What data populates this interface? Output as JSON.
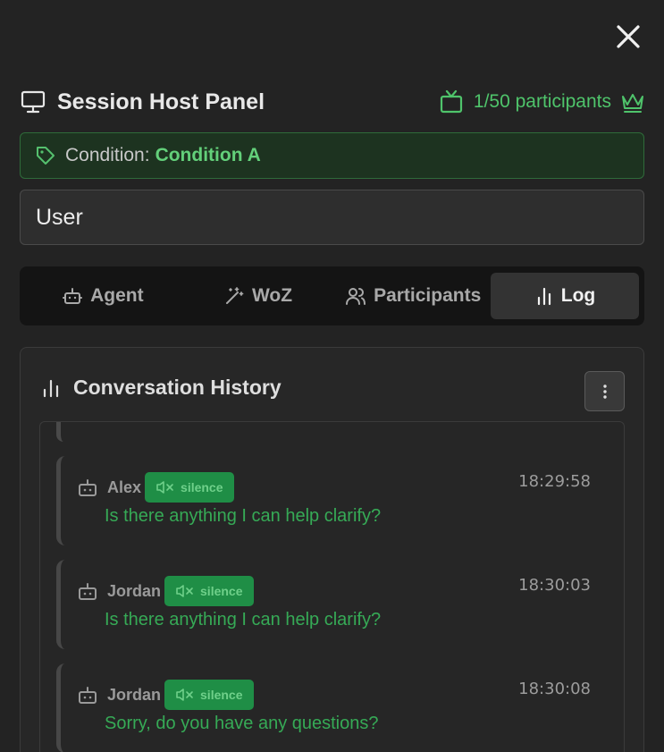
{
  "header": {
    "title": "Session Host Panel",
    "participants_label": "1/50 participants"
  },
  "condition": {
    "label": "Condition:",
    "value": "Condition A"
  },
  "role_input": {
    "value": "User"
  },
  "tabs": [
    {
      "label": "Agent",
      "icon": "robot-icon",
      "active": false
    },
    {
      "label": "WoZ",
      "icon": "magic-wand-icon",
      "active": false
    },
    {
      "label": "Participants",
      "icon": "users-icon",
      "active": false
    },
    {
      "label": "Log",
      "icon": "bar-chart-icon",
      "active": true
    }
  ],
  "history": {
    "title": "Conversation History",
    "messages": [
      {
        "speaker": "Alex",
        "badge": "silence",
        "time": "18:29:58",
        "text": "Is there anything I can help clarify?"
      },
      {
        "speaker": "Jordan",
        "badge": "silence",
        "time": "18:30:03",
        "text": "Is there anything I can help clarify?"
      },
      {
        "speaker": "Jordan",
        "badge": "silence",
        "time": "18:30:08",
        "text": "Sorry, do you have any questions?"
      }
    ]
  },
  "colors": {
    "background": "#232323",
    "accent_green": "#4fc46b",
    "badge_green": "#1f8e46",
    "message_text": "#36aa56"
  }
}
